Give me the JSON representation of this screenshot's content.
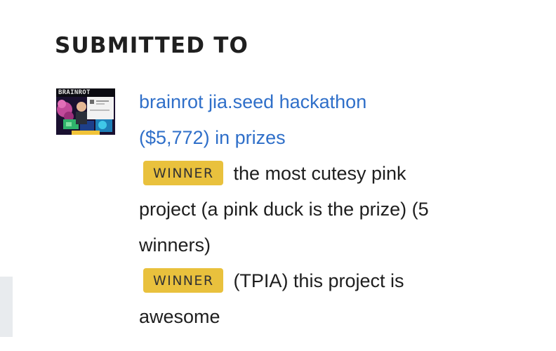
{
  "section": {
    "heading": "SUBMITTED TO"
  },
  "submission": {
    "thumbnail_text": "BRAINROT",
    "hackathon_name": "brainrot jia.seed hackathon",
    "prizes_total": "($5,772) in prizes",
    "prizes": [
      {
        "badge": "WINNER",
        "name": "the most cutesy pink project (a pink duck is the prize) (5 winners)"
      },
      {
        "badge": "WINNER",
        "name": "(TPIA) this project is awesome"
      }
    ]
  },
  "colors": {
    "link": "#2f6fc9",
    "badge_bg": "#e9c13d",
    "text": "#2c2c2c"
  }
}
